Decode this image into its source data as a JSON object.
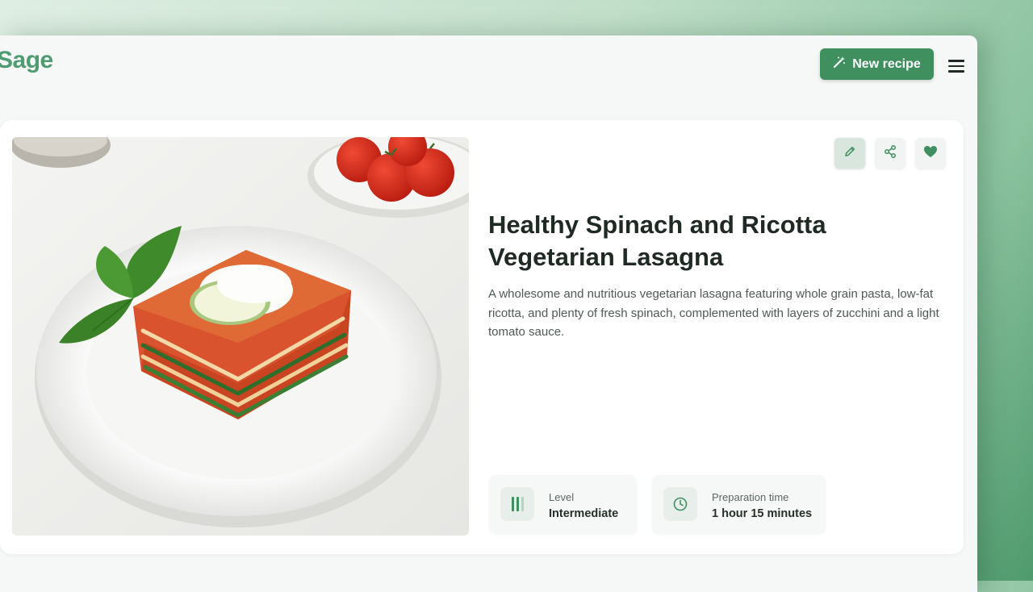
{
  "app": {
    "brand": "Sage"
  },
  "header": {
    "new_recipe_label": "New recipe"
  },
  "colors": {
    "accent": "#3f8f5f",
    "brand": "#4f9b72",
    "like": "#3f8f5f"
  },
  "recipe": {
    "title": "Healthy Spinach and Ricotta Vegetarian Lasagna",
    "description": "A wholesome and nutritious vegetarian lasagna featuring whole grain pasta, low-fat ricotta, and plenty of fresh spinach, complemented with layers of zucchini and a light tomato sauce.",
    "image_alt": "Slice of vegetarian lasagna on a white plate with basil and tomatoes",
    "actions": {
      "edit_icon": "pencil-icon",
      "share_icon": "share-icon",
      "favorite_icon": "heart-icon"
    },
    "stats": {
      "level": {
        "label": "Level",
        "value": "Intermediate",
        "icon": "bars-icon"
      },
      "prep_time": {
        "label": "Preparation time",
        "value": "1 hour 15 minutes",
        "icon": "clock-icon"
      }
    }
  }
}
